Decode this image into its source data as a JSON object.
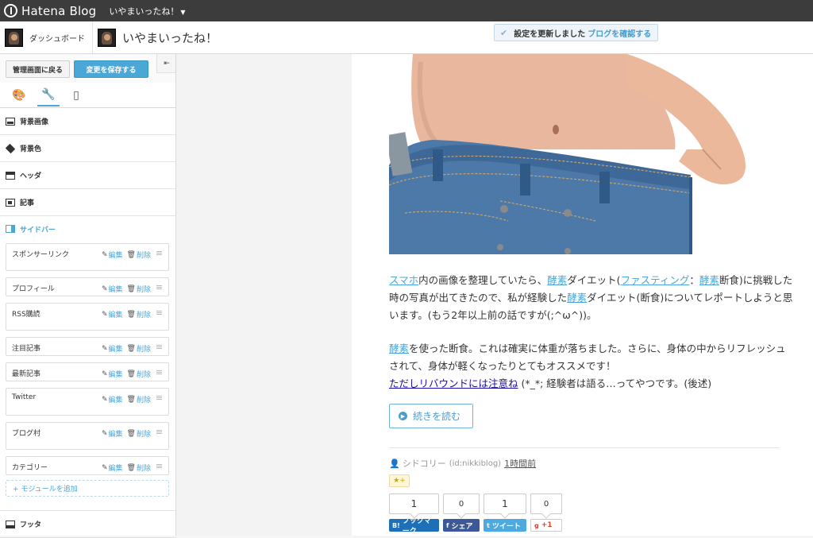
{
  "topbar": {
    "brand": "Hatena Blog",
    "blog_selector": "いやまいったね！"
  },
  "subbar": {
    "dashboard_label": "ダッシュボード",
    "blog_title": "いやまいったね！"
  },
  "notice": {
    "message": "設定を更新しました",
    "link": "ブログを確認する"
  },
  "sidebar": {
    "back_button": "管理画面に戻る",
    "save_button": "変更を保存する",
    "collapse_icon": "⇤",
    "sections": {
      "background_image": "背景画像",
      "background_color": "背景色",
      "header": "ヘッダ",
      "article": "記事",
      "sidebar": "サイドバー",
      "footer": "フッタ"
    },
    "modules": [
      {
        "name": "スポンサーリンク"
      },
      {
        "name": "プロフィール"
      },
      {
        "name": "RSS購読"
      },
      {
        "name": "注目記事"
      },
      {
        "name": "最新記事"
      },
      {
        "name": "Twitter"
      },
      {
        "name": "ブログ村"
      },
      {
        "name": "カテゴリー"
      }
    ],
    "edit_label": "編集",
    "delete_label": "削除",
    "add_module": "+ モジュールを追加"
  },
  "post": {
    "p1": {
      "a1": "スマホ",
      "t1": "内の画像を整理していたら、",
      "a2": "酵素",
      "t2": "ダイエット(",
      "a3": "ファスティング",
      "t3": "：",
      "a4": "酵素",
      "t4": "断食)に挑戦した時の写真が出てきたので、私が経験した",
      "a5": "酵素",
      "t5": "ダイエット(断食)についてレポートしようと思います。(もう2年以上前の話ですが(;^ω^))。"
    },
    "p2": {
      "a1": "酵素",
      "t1": "を使った断食。これは確実に体重が落ちました。さらに、身体の中からリフレッシュされて、身体が軽くなったりとてもオススメです！",
      "a2": "ただしリバウンドには注意ね",
      "t2": " (*_*; 経験者は語る…ってやつです。(後述)"
    },
    "read_more": "続きを読む",
    "author": "シドコリー",
    "author_id": "(id:nikkiblog)",
    "time": "1時間前",
    "star_label": "★+"
  },
  "share": {
    "hatena_count": "1",
    "hatena_label": "ブックマーク",
    "hatena_mark": "B!",
    "fb_count": "0",
    "fb_label": "シェア",
    "fb_mark": "f",
    "tw_count": "1",
    "tw_label": "ツイート",
    "tw_mark": "t",
    "gp_count": "0",
    "gp_label": "+1",
    "gp_mark": "g"
  },
  "colors": {
    "accent": "#4aa7d6",
    "topbar": "#3c3c3c",
    "facebook": "#3b5998",
    "hatena": "#1d6fb8",
    "twitter": "#4caae0"
  }
}
